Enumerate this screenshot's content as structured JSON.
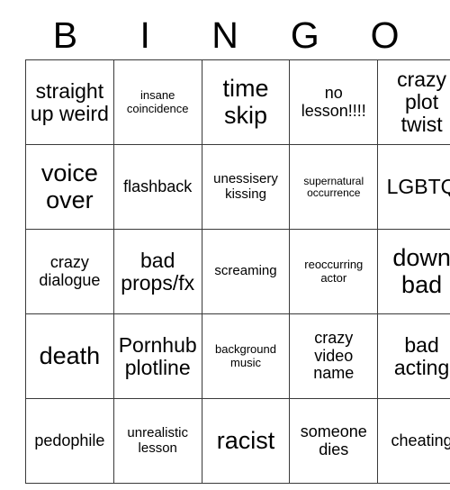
{
  "card": {
    "type": "bingo-card",
    "header_letters": [
      "B",
      "I",
      "N",
      "G",
      "O"
    ],
    "columns": 5,
    "rows": 5,
    "border_color": "#3a3a3a",
    "background_color": "#ffffff",
    "text_color": "#000000",
    "cells": [
      [
        {
          "text": "straight up weird",
          "size": "sz-lg"
        },
        {
          "text": "insane coincidence",
          "size": "sz-xs"
        },
        {
          "text": "time skip",
          "size": "sz-xl"
        },
        {
          "text": "no lesson!!!!",
          "size": "sz-md"
        },
        {
          "text": "crazy plot twist",
          "size": "sz-lg"
        }
      ],
      [
        {
          "text": "voice over",
          "size": "sz-xl"
        },
        {
          "text": "flashback",
          "size": "sz-md"
        },
        {
          "text": "unessisery kissing",
          "size": "sz-sm"
        },
        {
          "text": "supernatural occurrence",
          "size": "sz-xxs"
        },
        {
          "text": "LGBTQ",
          "size": "sz-lg"
        }
      ],
      [
        {
          "text": "crazy dialogue",
          "size": "sz-md"
        },
        {
          "text": "bad props/fx",
          "size": "sz-lg"
        },
        {
          "text": "screaming",
          "size": "sz-sm"
        },
        {
          "text": "reoccurring actor",
          "size": "sz-xs"
        },
        {
          "text": "down bad",
          "size": "sz-xl"
        }
      ],
      [
        {
          "text": "death",
          "size": "sz-xl"
        },
        {
          "text": "Pornhub plotline",
          "size": "sz-lg"
        },
        {
          "text": "background music",
          "size": "sz-xs"
        },
        {
          "text": "crazy video name",
          "size": "sz-md"
        },
        {
          "text": "bad acting",
          "size": "sz-lg"
        }
      ],
      [
        {
          "text": "pedophile",
          "size": "sz-md"
        },
        {
          "text": "unrealistic lesson",
          "size": "sz-sm"
        },
        {
          "text": "racist",
          "size": "sz-xl"
        },
        {
          "text": "someone dies",
          "size": "sz-md"
        },
        {
          "text": "cheating",
          "size": "sz-md"
        }
      ]
    ]
  }
}
